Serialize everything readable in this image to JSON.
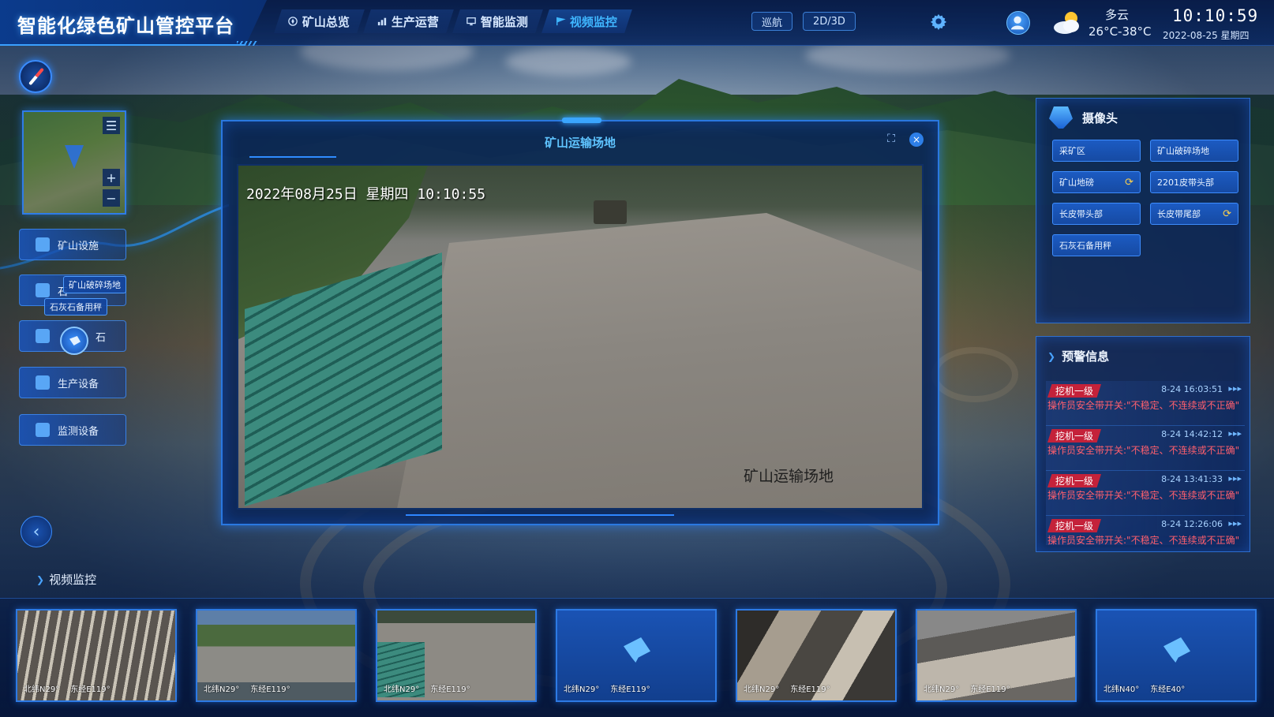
{
  "header": {
    "title": "智能化绿色矿山管控平台",
    "nav": [
      {
        "label": "矿山总览",
        "icon": "compass-icon",
        "active": false
      },
      {
        "label": "生产运营",
        "icon": "chart-icon",
        "active": false
      },
      {
        "label": "智能监测",
        "icon": "monitor-icon",
        "active": false
      },
      {
        "label": "视频监控",
        "icon": "flag-icon",
        "active": true
      }
    ],
    "cruise_label": "巡航",
    "view_toggle_label": "2D/3D",
    "weather": {
      "desc": "多云",
      "temp": "26°C-38°C",
      "icon": "partly-cloudy-icon"
    },
    "clock": {
      "time": "10:10:59",
      "date": "2022-08-25 星期四"
    }
  },
  "left": {
    "menu": [
      {
        "label": "矿山设施",
        "icon": "building-icon"
      },
      {
        "label": "生产设备",
        "icon": "equipment-icon"
      },
      {
        "label": "监测设备",
        "icon": "sensor-icon"
      }
    ],
    "popup_tags": [
      "矿山破碎场地",
      "石灰石备用秤"
    ],
    "partial_menu": {
      "label2": "石",
      "label3": "石"
    },
    "minimap_zoom_in": "+",
    "minimap_zoom_out": "−",
    "minimap_menu": "☰",
    "back_arrow": "‹",
    "section_label": "视频监控"
  },
  "video": {
    "title": "矿山运输场地",
    "osd_datetime": "2022年08月25日  星期四  10:10:55",
    "osd_name": "矿山运输场地",
    "expand_icon": "⛶",
    "close_icon": "×"
  },
  "cameras": {
    "title": "摄像头",
    "items": [
      {
        "label": "采矿区",
        "spinner": ""
      },
      {
        "label": "矿山破碎场地",
        "spinner": ""
      },
      {
        "label": "矿山地磅",
        "spinner": "⟳"
      },
      {
        "label": "2201皮带头部",
        "spinner": ""
      },
      {
        "label": "长皮带头部",
        "spinner": ""
      },
      {
        "label": "长皮带尾部",
        "spinner": "⟳"
      },
      {
        "label": "石灰石备用秤",
        "spinner": ""
      }
    ]
  },
  "alerts": {
    "title": "预警信息",
    "items": [
      {
        "level": "挖机一级",
        "time": "8-24 16:03:51",
        "more": "▸▸▸",
        "msg": "操作员安全带开关:\"不稳定、不连续或不正确\""
      },
      {
        "level": "挖机一级",
        "time": "8-24 14:42:12",
        "more": "▸▸▸",
        "msg": "操作员安全带开关:\"不稳定、不连续或不正确\""
      },
      {
        "level": "挖机一级",
        "time": "8-24 13:41:33",
        "more": "▸▸▸",
        "msg": "操作员安全带开关:\"不稳定、不连续或不正确\""
      },
      {
        "level": "挖机一级",
        "time": "8-24 12:26:06",
        "more": "▸▸▸",
        "msg": "操作员安全带开关:\"不稳定、不连续或不正确\""
      }
    ]
  },
  "thumbnails": [
    {
      "lat": "北纬N29°",
      "lon": "东经E119°",
      "style": "t1"
    },
    {
      "lat": "北纬N29°",
      "lon": "东经E119°",
      "style": "t2"
    },
    {
      "lat": "北纬N29°",
      "lon": "东经E119°",
      "style": "t3"
    },
    {
      "lat": "北纬N29°",
      "lon": "东经E119°",
      "style": "empty"
    },
    {
      "lat": "北纬N29°",
      "lon": "东经E119°",
      "style": "t5"
    },
    {
      "lat": "北纬N29°",
      "lon": "东经E119°",
      "style": "t6"
    },
    {
      "lat": "北纬N40°",
      "lon": "东经E40°",
      "style": "empty"
    }
  ],
  "colors": {
    "accent": "#3aa0ff",
    "alert": "#c4223a",
    "alert_text": "#ff5f6d",
    "panel_bg": "#0a245c"
  }
}
